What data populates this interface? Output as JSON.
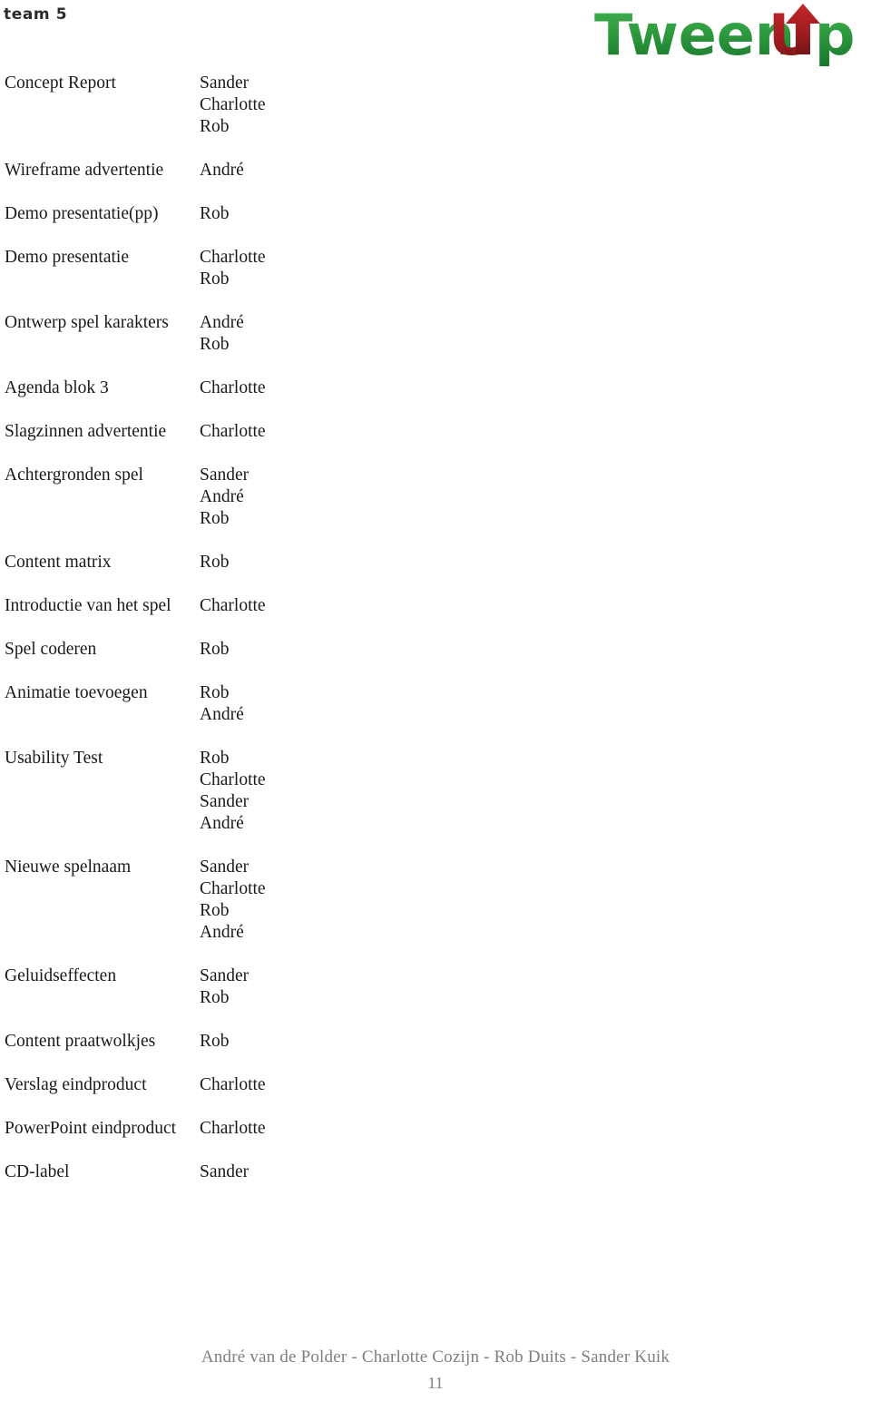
{
  "header": {
    "team_label": "team 5",
    "logo": {
      "name": "tweenup-logo",
      "word_one": "Tween",
      "word_two_u": "U",
      "word_two_p": "p",
      "green": "#2e9b3f",
      "green_dark": "#1d7a30",
      "red": "#a81f22",
      "red_dark": "#7e1518"
    }
  },
  "task_list": {
    "rows": [
      {
        "task": "Concept Report",
        "members": [
          "Sander",
          "Charlotte",
          "Rob"
        ]
      },
      {
        "task": "Wireframe advertentie",
        "members": [
          "André"
        ]
      },
      {
        "task": "Demo presentatie(pp)",
        "members": [
          "Rob"
        ]
      },
      {
        "task": "Demo presentatie",
        "members": [
          "Charlotte",
          "Rob"
        ]
      },
      {
        "task": "Ontwerp spel karakters",
        "members": [
          "André",
          "Rob"
        ]
      },
      {
        "task": "Agenda blok 3",
        "members": [
          "Charlotte"
        ]
      },
      {
        "task": "Slagzinnen advertentie",
        "members": [
          "Charlotte"
        ]
      },
      {
        "task": "Achtergronden spel",
        "members": [
          "Sander",
          "André",
          "Rob"
        ]
      },
      {
        "task": "Content matrix",
        "members": [
          "Rob"
        ]
      },
      {
        "task": "Introductie van het spel",
        "members": [
          "Charlotte"
        ]
      },
      {
        "task": "Spel coderen",
        "members": [
          "Rob"
        ]
      },
      {
        "task": "Animatie toevoegen",
        "members": [
          "Rob",
          "André"
        ]
      },
      {
        "task": "Usability Test",
        "members": [
          "Rob",
          "Charlotte",
          "Sander",
          "André"
        ]
      },
      {
        "task": "Nieuwe spelnaam",
        "members": [
          "Sander",
          "Charlotte",
          "Rob",
          "André"
        ]
      },
      {
        "task": "Geluidseffecten",
        "members": [
          "Sander",
          "Rob"
        ]
      },
      {
        "task": "Content praatwolkjes",
        "members": [
          "Rob"
        ]
      },
      {
        "task": "Verslag eindproduct",
        "members": [
          "Charlotte"
        ]
      },
      {
        "task": "PowerPoint eindproduct",
        "members": [
          "Charlotte"
        ]
      },
      {
        "task": "CD-label",
        "members": [
          "Sander"
        ]
      }
    ]
  },
  "footer": {
    "authors": "André van de Polder - Charlotte Cozijn - Rob Duits - Sander Kuik",
    "page_number": "11",
    "color": "#7e7e7e"
  }
}
